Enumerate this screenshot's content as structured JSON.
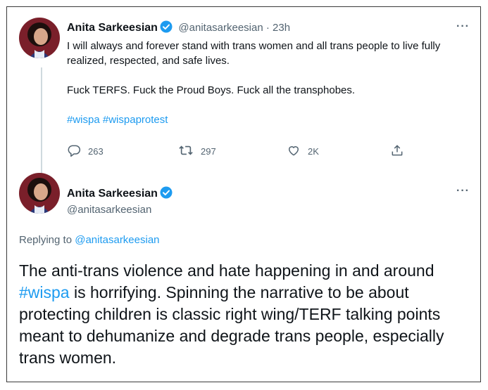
{
  "tweet1": {
    "author_name": "Anita Sarkeesian",
    "handle": "@anitasarkeesian",
    "separator": " · ",
    "time": "23h",
    "text_line1": "I will always and forever stand with trans women and all trans people to live fully realized, respected, and safe lives.",
    "text_line2": "Fuck TERFS. Fuck the Proud Boys. Fuck all the transphobes.",
    "hashtag1": "#wispa",
    "hashtag2": "#wispaprotest",
    "reply_count": "263",
    "retweet_count": "297",
    "like_count": "2K",
    "more_label": "···"
  },
  "tweet2": {
    "author_name": "Anita Sarkeesian",
    "handle": "@anitasarkeesian",
    "more_label": "···",
    "replying_prefix": "Replying to ",
    "replying_to": "@anitasarkeesian",
    "text_before_tag": "The anti-trans violence and hate happening in and around ",
    "hashtag": "#wispa",
    "text_after_tag": " is horrifying. Spinning the narrative to be about protecting children is classic right wing/TERF talking points meant to dehumanize and degrade trans people, especially trans women."
  },
  "colors": {
    "link": "#1d9bf0",
    "verified": "#1d9bf0",
    "secondary_text": "#536471",
    "thread_line": "#cfd9de"
  },
  "icons": [
    "reply-icon",
    "retweet-icon",
    "like-icon",
    "share-icon",
    "verified-badge-icon",
    "more-icon"
  ]
}
